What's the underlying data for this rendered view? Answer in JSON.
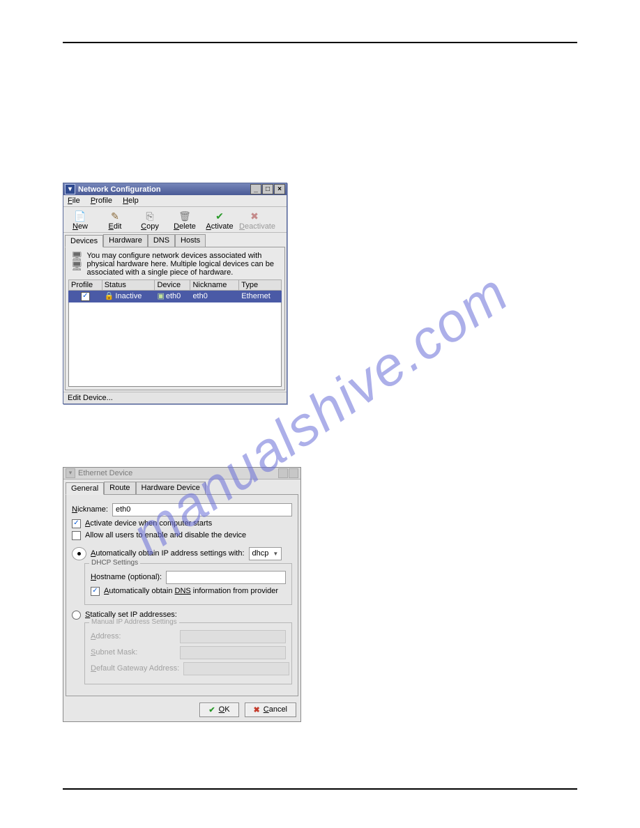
{
  "watermark": "manualshive.com",
  "win1": {
    "title": "Network Configuration",
    "menu": {
      "file": "File",
      "profile": "Profile",
      "help": "Help"
    },
    "toolbar": {
      "new": "New",
      "edit": "Edit",
      "copy": "Copy",
      "delete": "Delete",
      "activate": "Activate",
      "deactivate": "Deactivate"
    },
    "tabs": {
      "devices": "Devices",
      "hardware": "Hardware",
      "dns": "DNS",
      "hosts": "Hosts"
    },
    "hint": "You may configure network devices associated with physical hardware here. Multiple logical devices can be associated with a single piece of hardware.",
    "table": {
      "cols": {
        "profile": "Profile",
        "status": "Status",
        "device": "Device",
        "nickname": "Nickname",
        "type": "Type"
      },
      "row": {
        "status": "Inactive",
        "device": "eth0",
        "nickname": "eth0",
        "type": "Ethernet"
      }
    },
    "status": "Edit Device..."
  },
  "win2": {
    "title": "Ethernet Device",
    "tabs": {
      "general": "General",
      "route": "Route",
      "hw": "Hardware Device"
    },
    "nickname_label": "Nickname:",
    "nickname_value": "eth0",
    "activate_label": "Activate device when computer starts",
    "allow_label": "Allow all users to enable and disable the device",
    "auto_label": "Automatically obtain IP address settings with:",
    "auto_value": "dhcp",
    "dhcp_legend": "DHCP Settings",
    "hostname_label": "Hostname (optional):",
    "hostname_value": "",
    "autodns_label": "Automatically obtain DNS information from provider",
    "static_label": "Statically set IP addresses:",
    "manual_legend": "Manual IP Address Settings",
    "addr_label": "Address:",
    "mask_label": "Subnet Mask:",
    "gw_label": "Default Gateway Address:",
    "ok": "OK",
    "cancel": "Cancel"
  }
}
